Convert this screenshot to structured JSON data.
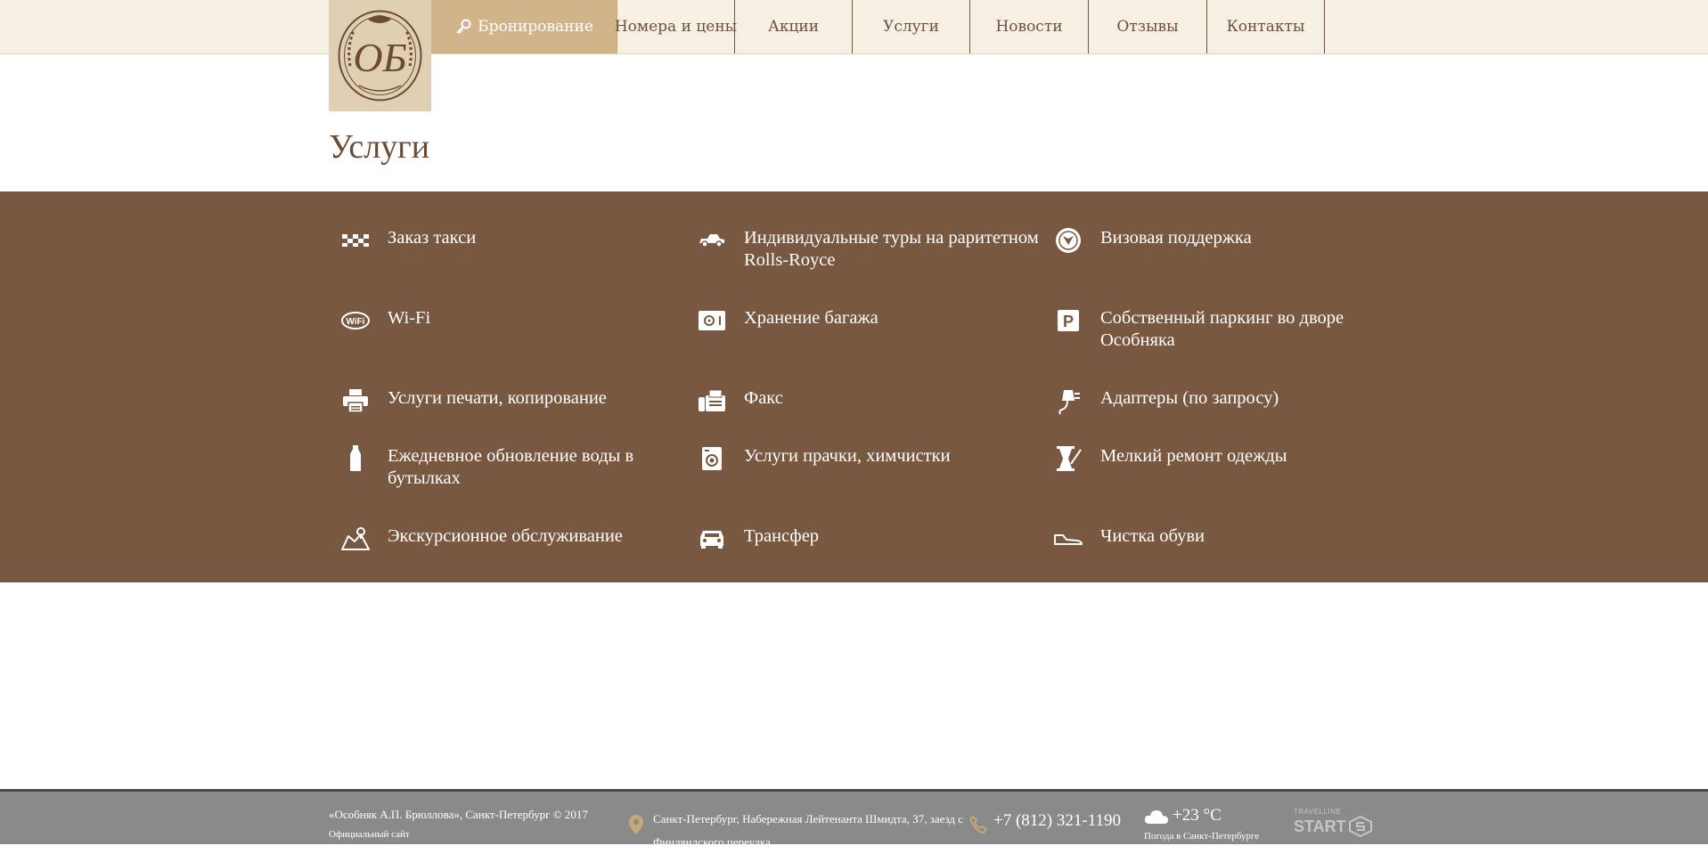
{
  "brand": {
    "logo_name": "logo-emblem"
  },
  "nav": {
    "booking": "Бронирование",
    "items": [
      "Номера и цены",
      "Акции",
      "Услуги",
      "Новости",
      "Отзывы",
      "Контакты"
    ]
  },
  "page": {
    "title": "Услуги"
  },
  "services": [
    {
      "label": "Заказ такси",
      "icon": "taxi-icon"
    },
    {
      "label": "Индивидуальные туры на раритетном Rolls-Royce",
      "icon": "car-retro-icon"
    },
    {
      "label": "Визовая поддержка",
      "icon": "visa-emblem-icon"
    },
    {
      "label": "Wi-Fi",
      "icon": "wifi-icon"
    },
    {
      "label": "Хранение багажа",
      "icon": "safe-icon"
    },
    {
      "label": "Собственный паркинг во дворе Особняка",
      "icon": "parking-icon"
    },
    {
      "label": "Услуги печати, копирование",
      "icon": "printer-icon"
    },
    {
      "label": "Факс",
      "icon": "fax-icon"
    },
    {
      "label": "Адаптеры (по запросу)",
      "icon": "plug-icon"
    },
    {
      "label": "Ежедневное обновление воды в бутылках",
      "icon": "bottle-icon"
    },
    {
      "label": "Услуги прачки, химчистки",
      "icon": "washing-machine-icon"
    },
    {
      "label": "Мелкий ремонт одежды",
      "icon": "sewing-icon"
    },
    {
      "label": "Экскурсионное обслуживание",
      "icon": "map-icon"
    },
    {
      "label": "Трансфер",
      "icon": "car-icon"
    },
    {
      "label": "Чистка обуви",
      "icon": "shoe-icon"
    }
  ],
  "footer": {
    "copyright": "«Особняк А.П. Брюллова», Санкт-Петербург © 2017",
    "official": "Официальный сайт",
    "address": "Санкт-Петербург, Набережная Лейтенанта Шмидта, 37, заезд с Финляндского переулка",
    "phone": "+7 (812) 321-1190",
    "temp": "+23 °C",
    "weather_label": "Погода в Санкт-Петербурге",
    "travelline_small": "TRAVELLINE",
    "travelline_big": "START"
  },
  "colors": {
    "brown": "#785840",
    "cream": "#f6f0e4",
    "tan": "#d2b48a",
    "footer": "#8a8a8a"
  }
}
